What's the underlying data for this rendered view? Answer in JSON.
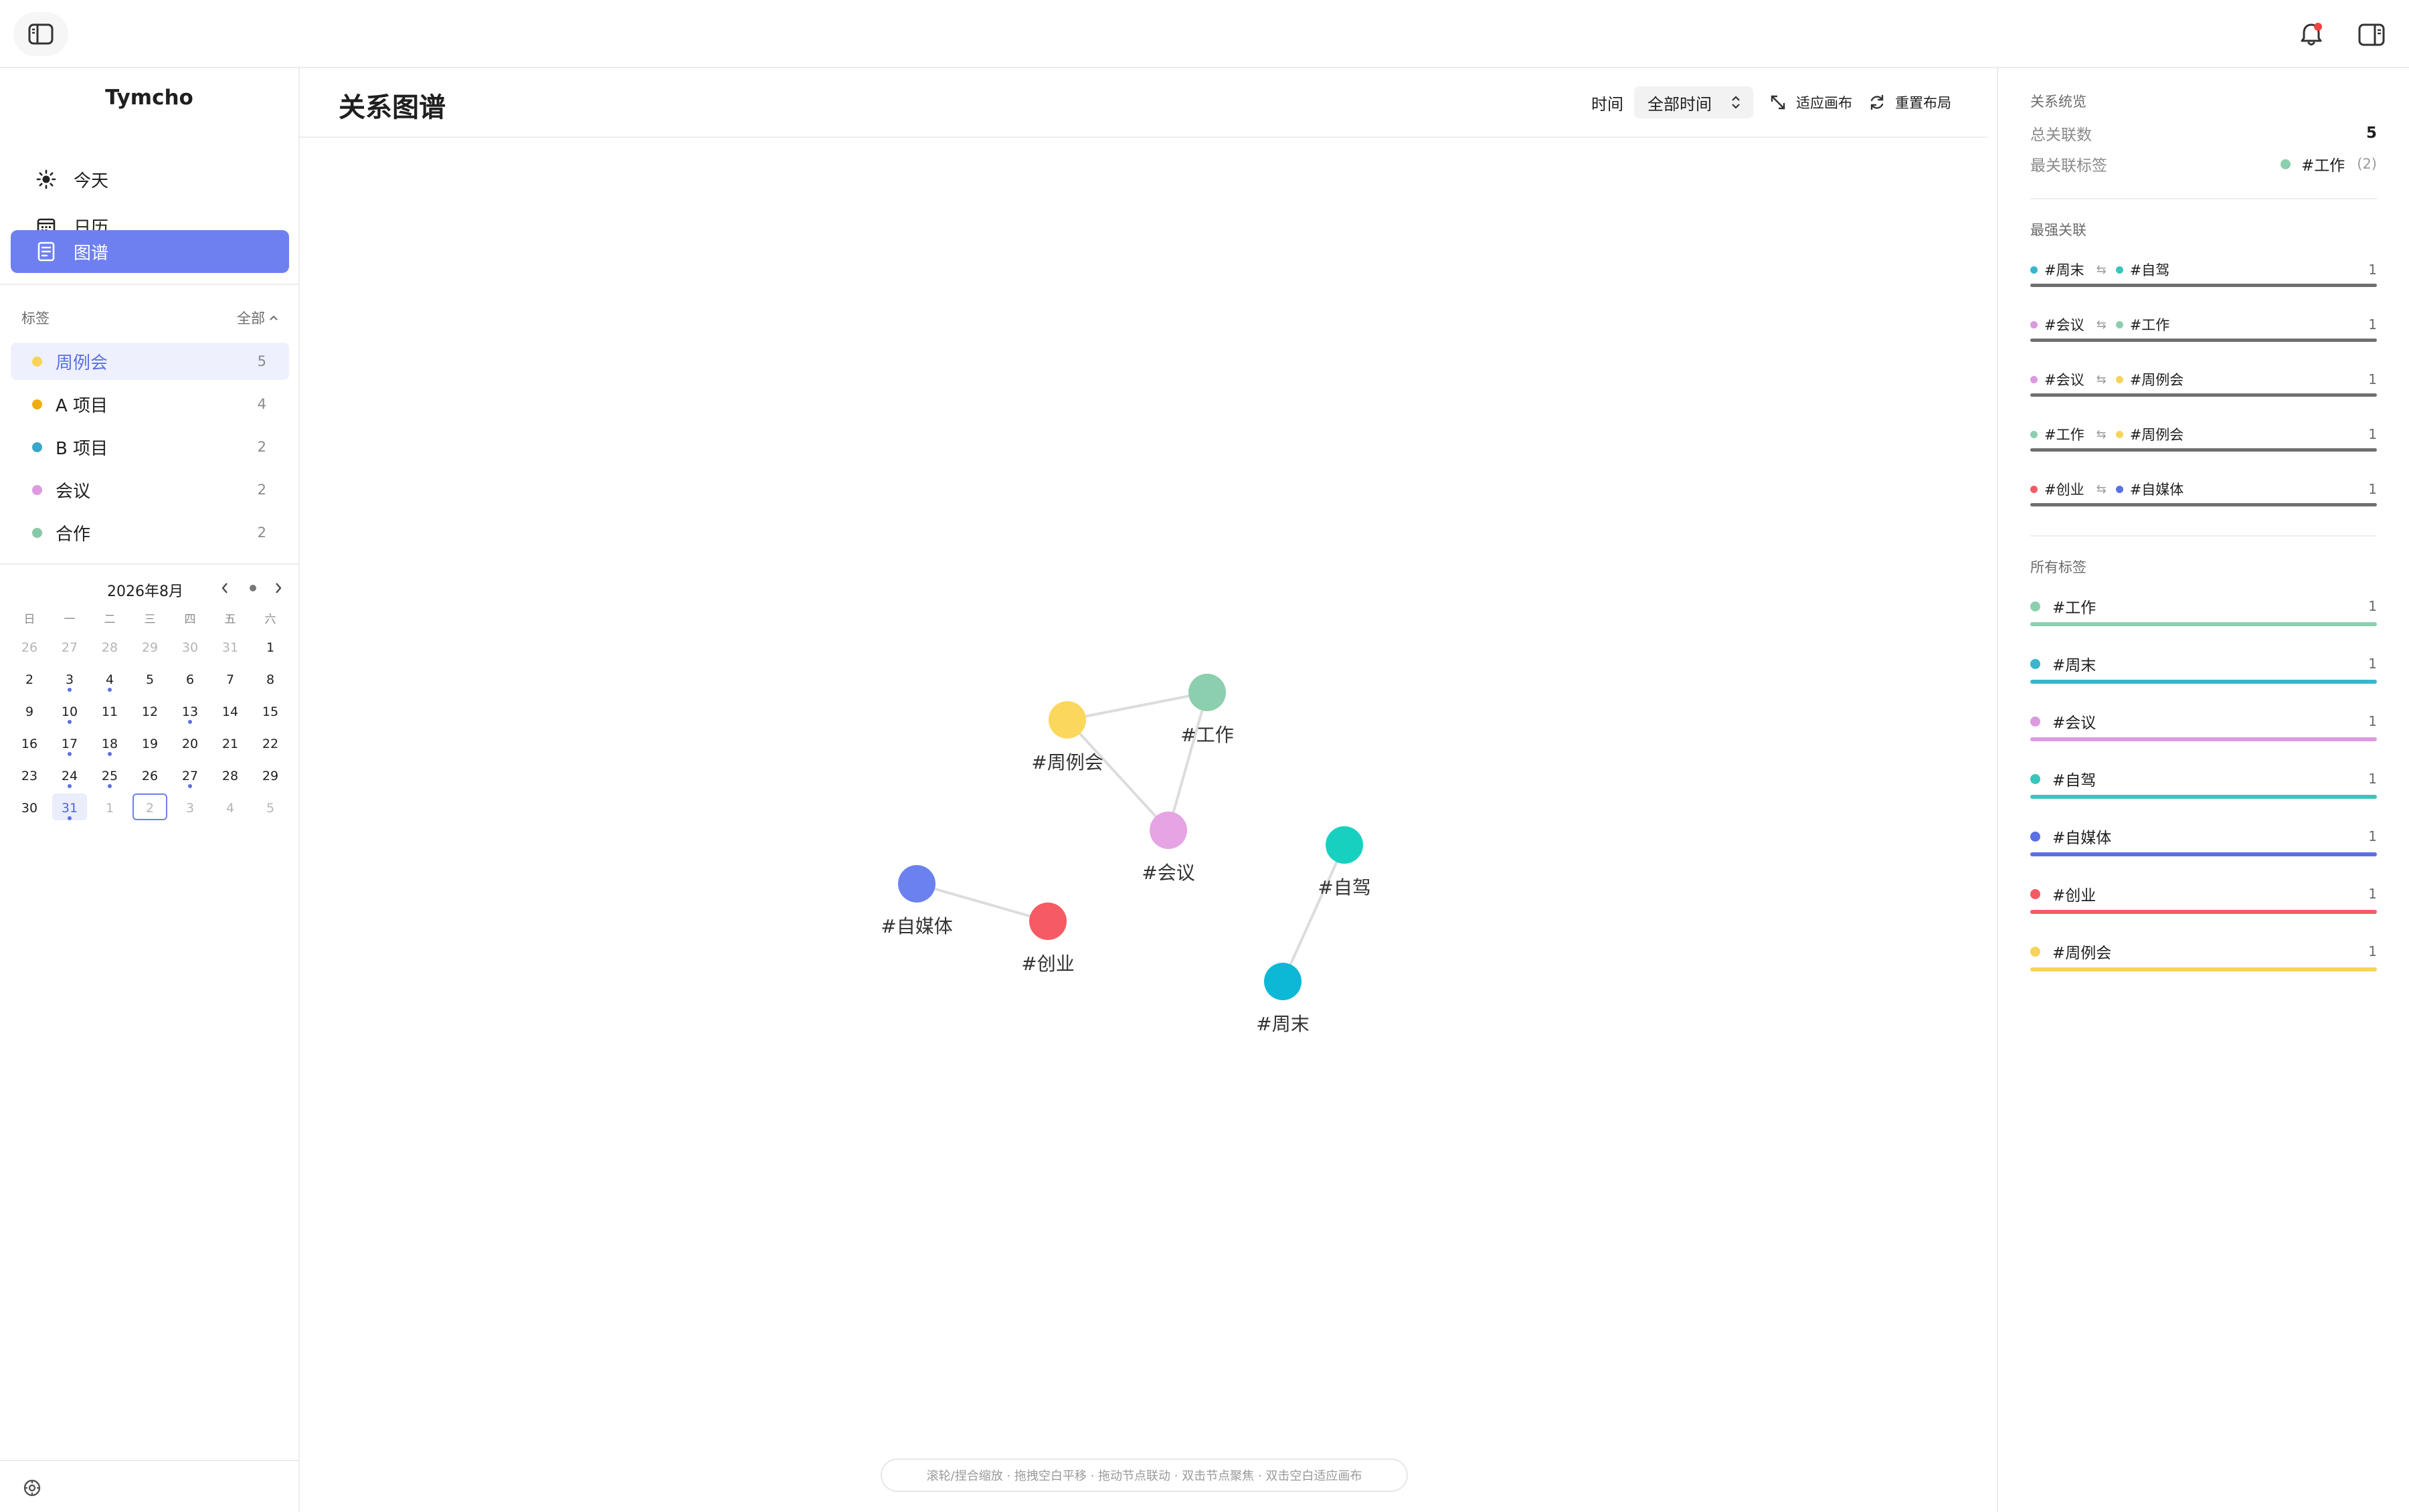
{
  "app": {
    "name": "Tymcho"
  },
  "nav": [
    {
      "label": "今天",
      "icon": "sun-icon"
    },
    {
      "label": "日历",
      "icon": "calendar-icon"
    },
    {
      "label": "图谱",
      "icon": "graph-document-icon",
      "active": true
    }
  ],
  "tags": {
    "header": "标签",
    "all_label": "全部",
    "items": [
      {
        "name": "周例会",
        "count": "5",
        "color": "#f7d35a",
        "active": true
      },
      {
        "name": "A 项目",
        "count": "4",
        "color": "#f0ad12"
      },
      {
        "name": "B 项目",
        "count": "2",
        "color": "#38a8c8"
      },
      {
        "name": "会议",
        "count": "2",
        "color": "#dc9ae0"
      },
      {
        "name": "合作",
        "count": "2",
        "color": "#86c9a8"
      }
    ]
  },
  "calendar": {
    "title": "2026年8月",
    "weekdays": [
      "日",
      "一",
      "二",
      "三",
      "四",
      "五",
      "六"
    ],
    "weeks": [
      [
        {
          "d": "26",
          "m": true
        },
        {
          "d": "27",
          "m": true
        },
        {
          "d": "28",
          "m": true
        },
        {
          "d": "29",
          "m": true
        },
        {
          "d": "30",
          "m": true
        },
        {
          "d": "31",
          "m": true
        },
        {
          "d": "1"
        }
      ],
      [
        {
          "d": "2"
        },
        {
          "d": "3",
          "e": true
        },
        {
          "d": "4",
          "e": true
        },
        {
          "d": "5"
        },
        {
          "d": "6"
        },
        {
          "d": "7"
        },
        {
          "d": "8"
        }
      ],
      [
        {
          "d": "9"
        },
        {
          "d": "10",
          "e": true
        },
        {
          "d": "11"
        },
        {
          "d": "12"
        },
        {
          "d": "13",
          "e": true
        },
        {
          "d": "14"
        },
        {
          "d": "15"
        }
      ],
      [
        {
          "d": "16"
        },
        {
          "d": "17",
          "e": true
        },
        {
          "d": "18",
          "e": true
        },
        {
          "d": "19"
        },
        {
          "d": "20"
        },
        {
          "d": "21"
        },
        {
          "d": "22"
        }
      ],
      [
        {
          "d": "23"
        },
        {
          "d": "24",
          "e": true
        },
        {
          "d": "25",
          "e": true
        },
        {
          "d": "26"
        },
        {
          "d": "27",
          "e": true
        },
        {
          "d": "28"
        },
        {
          "d": "29"
        }
      ],
      [
        {
          "d": "30"
        },
        {
          "d": "31",
          "e": true,
          "today": true
        },
        {
          "d": "1",
          "m": true
        },
        {
          "d": "2",
          "m": true,
          "selected": true
        },
        {
          "d": "3",
          "m": true
        },
        {
          "d": "4",
          "m": true
        },
        {
          "d": "5",
          "m": true
        }
      ]
    ]
  },
  "main": {
    "title": "关系图谱",
    "time_label": "时间",
    "time_value": "全部时间",
    "fit_label": "适应画布",
    "reset_label": "重置布局",
    "hint": "滚轮/捏合缩放 · 拖拽空白平移 · 拖动节点联动 · 双击节点聚焦 · 双击空白适应画布"
  },
  "graph": {
    "nodes": [
      {
        "id": "weekly",
        "label": "#周例会",
        "color": "#fbd85d"
      },
      {
        "id": "work",
        "label": "#工作",
        "color": "#8ccfae"
      },
      {
        "id": "meeting",
        "label": "#会议",
        "color": "#e6a4e4"
      },
      {
        "id": "media",
        "label": "#自媒体",
        "color": "#6b82ee"
      },
      {
        "id": "startup",
        "label": "#创业",
        "color": "#f65a64"
      },
      {
        "id": "drive",
        "label": "#自驾",
        "color": "#18d0c0"
      },
      {
        "id": "weekend",
        "label": "#周末",
        "color": "#0cb8d6"
      }
    ],
    "edges": [
      [
        "weekly",
        "work"
      ],
      [
        "weekly",
        "meeting"
      ],
      [
        "work",
        "meeting"
      ],
      [
        "media",
        "startup"
      ],
      [
        "drive",
        "weekend"
      ]
    ]
  },
  "overview": {
    "section_label": "关系统览",
    "total_label": "总关联数",
    "total_value": "5",
    "top_label": "最关联标签",
    "top_tag": "#工作",
    "top_tag_color": "#8ccfae",
    "top_tag_count": "(2)"
  },
  "strongest": {
    "section_label": "最强关联",
    "swap_icon": "⇆",
    "pairs": [
      {
        "a": "#周末",
        "a_color": "#38b6cc",
        "b": "#自驾",
        "b_color": "#36c7bc",
        "count": "1"
      },
      {
        "a": "#会议",
        "a_color": "#dc9ae0",
        "b": "#工作",
        "b_color": "#8ccfae",
        "count": "1"
      },
      {
        "a": "#会议",
        "a_color": "#dc9ae0",
        "b": "#周例会",
        "b_color": "#f7d35a",
        "count": "1"
      },
      {
        "a": "#工作",
        "a_color": "#8ccfae",
        "b": "#周例会",
        "b_color": "#f7d35a",
        "count": "1"
      },
      {
        "a": "#创业",
        "a_color": "#f65a64",
        "b": "#自媒体",
        "b_color": "#5b6fe6",
        "count": "1"
      }
    ]
  },
  "all_tags": {
    "section_label": "所有标签",
    "items": [
      {
        "name": "#工作",
        "count": "1",
        "color": "#8ccfae"
      },
      {
        "name": "#周末",
        "count": "1",
        "color": "#38b6cc"
      },
      {
        "name": "#会议",
        "count": "1",
        "color": "#dc9ae0"
      },
      {
        "name": "#自驾",
        "count": "1",
        "color": "#36c7bc"
      },
      {
        "name": "#自媒体",
        "count": "1",
        "color": "#5b6fe6"
      },
      {
        "name": "#创业",
        "count": "1",
        "color": "#f65a64"
      },
      {
        "name": "#周例会",
        "count": "1",
        "color": "#f7d35a"
      }
    ]
  }
}
